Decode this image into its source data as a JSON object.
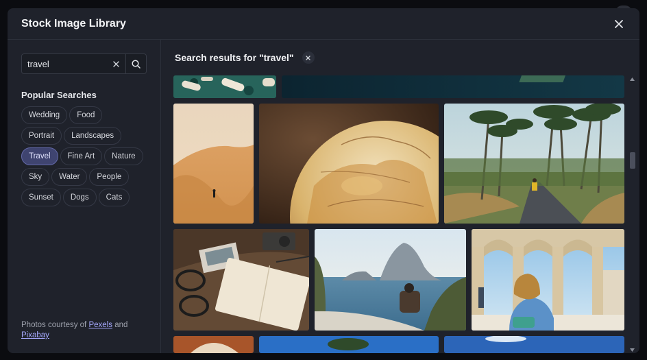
{
  "modal": {
    "title": "Stock Image Library"
  },
  "search": {
    "value": "travel",
    "placeholder": ""
  },
  "popular": {
    "title": "Popular Searches",
    "chips": [
      {
        "label": "Wedding",
        "active": false
      },
      {
        "label": "Food",
        "active": false
      },
      {
        "label": "Portrait",
        "active": false
      },
      {
        "label": "Landscapes",
        "active": false
      },
      {
        "label": "Travel",
        "active": true
      },
      {
        "label": "Fine Art",
        "active": false
      },
      {
        "label": "Nature",
        "active": false
      },
      {
        "label": "Sky",
        "active": false
      },
      {
        "label": "Water",
        "active": false
      },
      {
        "label": "People",
        "active": false
      },
      {
        "label": "Sunset",
        "active": false
      },
      {
        "label": "Dogs",
        "active": false
      },
      {
        "label": "Cats",
        "active": false
      }
    ]
  },
  "credits": {
    "prefix": "Photos courtesy of",
    "link1": "Pexels",
    "middle": "and",
    "link2": "Pixabay"
  },
  "results": {
    "title": "Search results for \"travel\""
  },
  "colors": {
    "modal_bg": "#1f222b",
    "active_chip": "#3f4470",
    "link": "#a6a9ff"
  },
  "icons": {
    "close": "close-icon",
    "clear": "clear-search-icon",
    "search": "search-icon"
  }
}
